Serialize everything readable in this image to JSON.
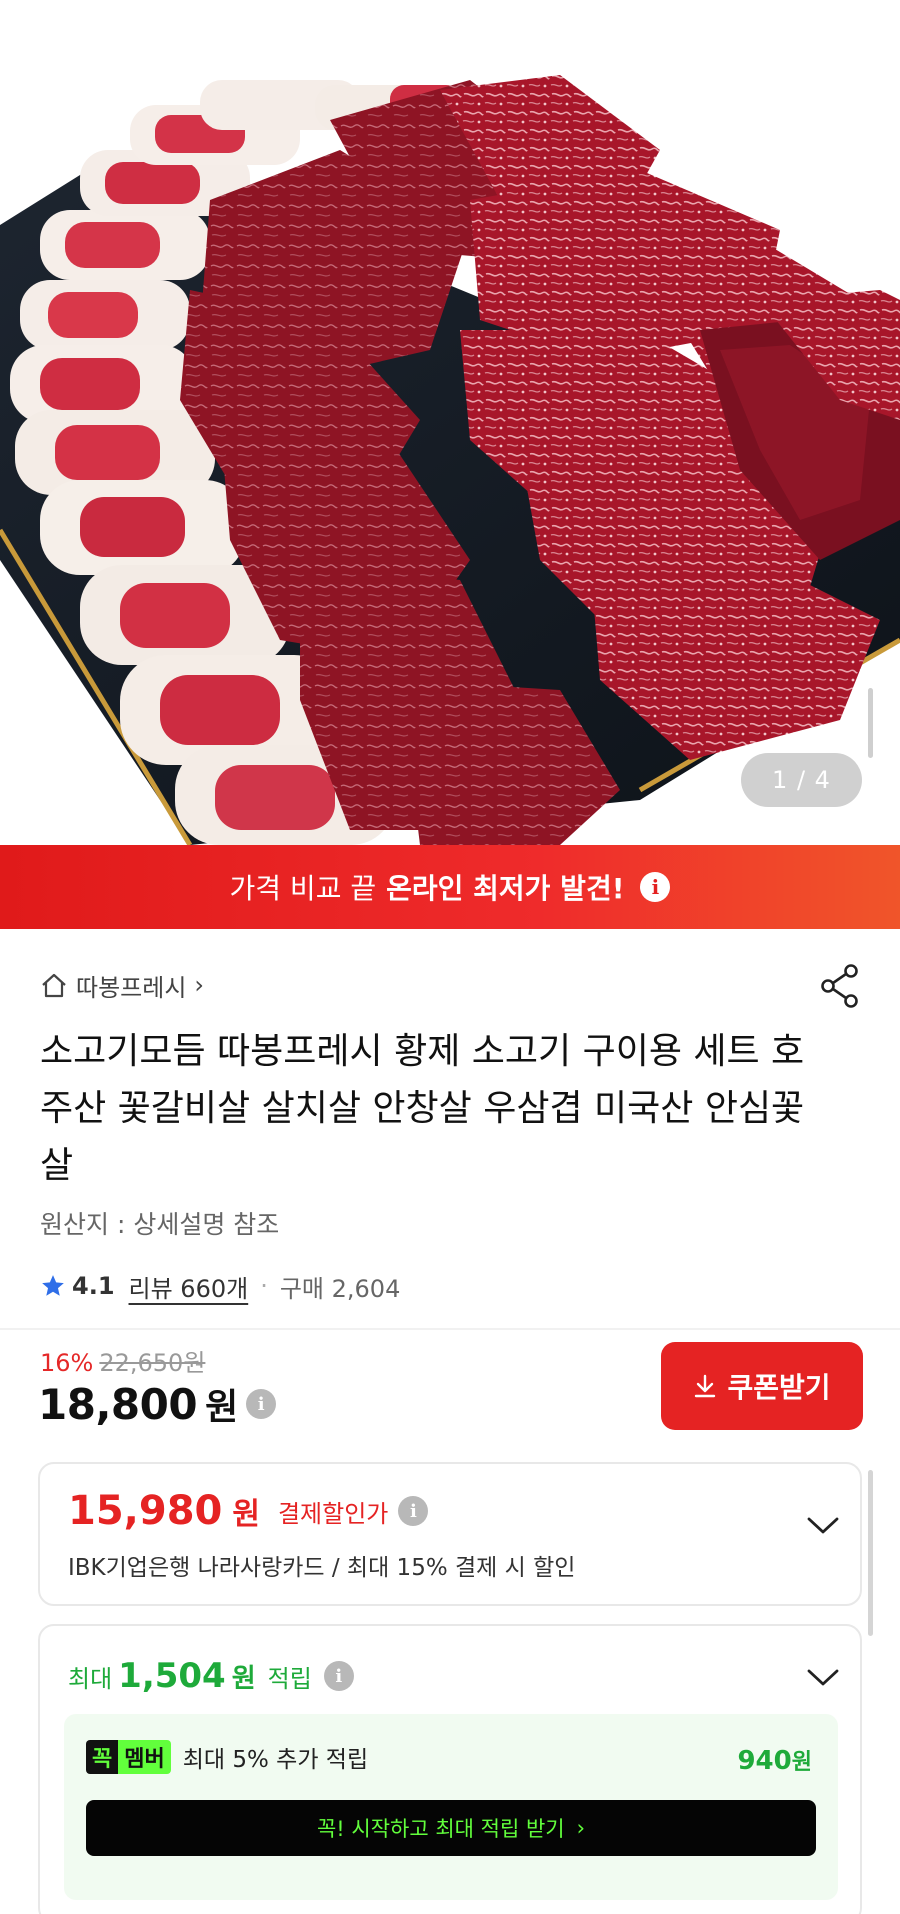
{
  "gallery": {
    "counter": "1 / 4"
  },
  "promo_banner": {
    "prefix": "가격 비교 끝",
    "highlight": "온라인 최저가 발견!",
    "info_icon": "info-icon"
  },
  "store": {
    "name": "따봉프레시",
    "chevron": "›"
  },
  "product": {
    "title": "소고기모듬 따봉프레시 황제 소고기 구이용 세트 호주산 꽃갈비살 살치살 안창살 우삼겹 미국산 안심꽃살",
    "origin": "원산지 : 상세설명 참조",
    "rating": "4.1",
    "reviews": "리뷰 660개",
    "separator": "·",
    "purchases": "구매 2,604"
  },
  "price": {
    "discount_pct": "16%",
    "original": "22,650원",
    "current_number": "18,800",
    "current_unit": "원",
    "coupon_button": "쿠폰받기"
  },
  "card_discount": {
    "price_number": "15,980",
    "price_unit": "원",
    "label": "결제할인가",
    "description": "IBK기업은행 나라사랑카드 / 최대 15% 결제 시 할인"
  },
  "rewards": {
    "prefix": "최대",
    "points": "1,504",
    "unit": "원",
    "suffix": "적립",
    "member_badge_a": "꼭",
    "member_badge_b": "멤버",
    "member_text": "최대 5% 추가 적립",
    "member_points": "940",
    "member_unit": "원",
    "start_button": "꼭! 시작하고 최대 적립 받기",
    "start_chevron": "›"
  },
  "colors": {
    "brand_red": "#e52323",
    "reward_green": "#1eaa3a",
    "member_lime": "#62ff3c"
  }
}
